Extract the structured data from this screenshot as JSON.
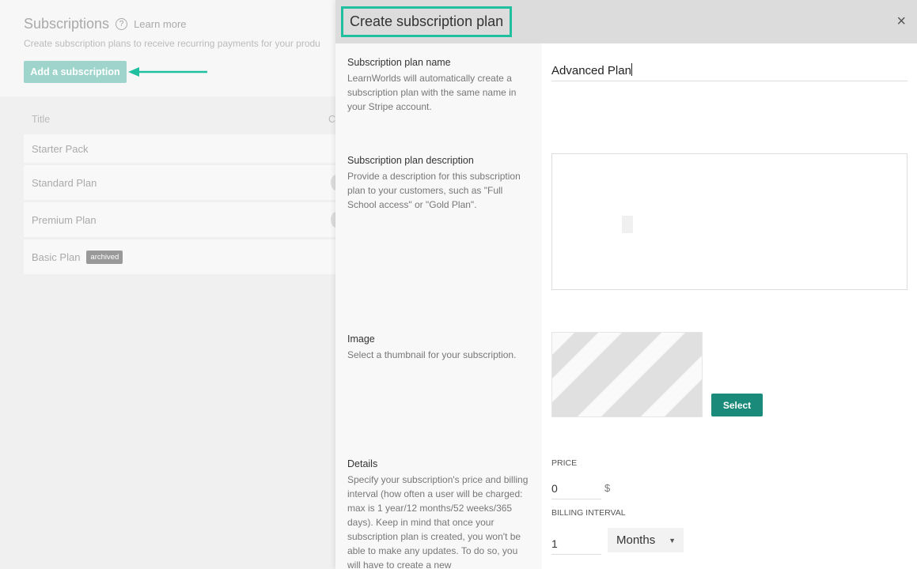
{
  "background": {
    "title": "Subscriptions",
    "learn_more": "Learn more",
    "subtitle": "Create subscription plans to receive recurring payments for your produ",
    "add_button": "Add a subscription",
    "table": {
      "col_title": "Title",
      "col_2": "C",
      "rows": [
        {
          "title": "Starter Pack",
          "badge": ""
        },
        {
          "title": "Standard Plan",
          "badge": ""
        },
        {
          "title": "Premium Plan",
          "badge": ""
        },
        {
          "title": "Basic Plan",
          "badge": "archived"
        }
      ]
    }
  },
  "panel": {
    "title": "Create subscription plan",
    "close_icon": "×",
    "sections": {
      "name": {
        "heading": "Subscription plan name",
        "help": "LearnWorlds will automatically create a subscription plan with the same name in your Stripe account.",
        "value": "Advanced Plan"
      },
      "description": {
        "heading": "Subscription plan description",
        "help": "Provide a description for this subscription plan to your customers, such as \"Full School access\" or \"Gold Plan\".",
        "value": ""
      },
      "image": {
        "heading": "Image",
        "help": "Select a thumbnail for your subscription.",
        "select_button": "Select"
      },
      "details": {
        "heading": "Details",
        "help": "Specify your subscription's price and billing interval (how often a user will be charged: max is 1 year/12 months/52 weeks/365 days). Keep in mind that once your subscription plan is created, you won't be able to make any updates. To do so, you will have to create a new",
        "price_label": "PRICE",
        "price_value": "0",
        "currency": "$",
        "interval_label": "BILLING INTERVAL",
        "interval_value": "1",
        "interval_unit": "Months"
      }
    }
  },
  "colors": {
    "accent": "#1fbf9f",
    "button_dark": "#1a8a7a",
    "button_light": "#9ed4cb"
  }
}
